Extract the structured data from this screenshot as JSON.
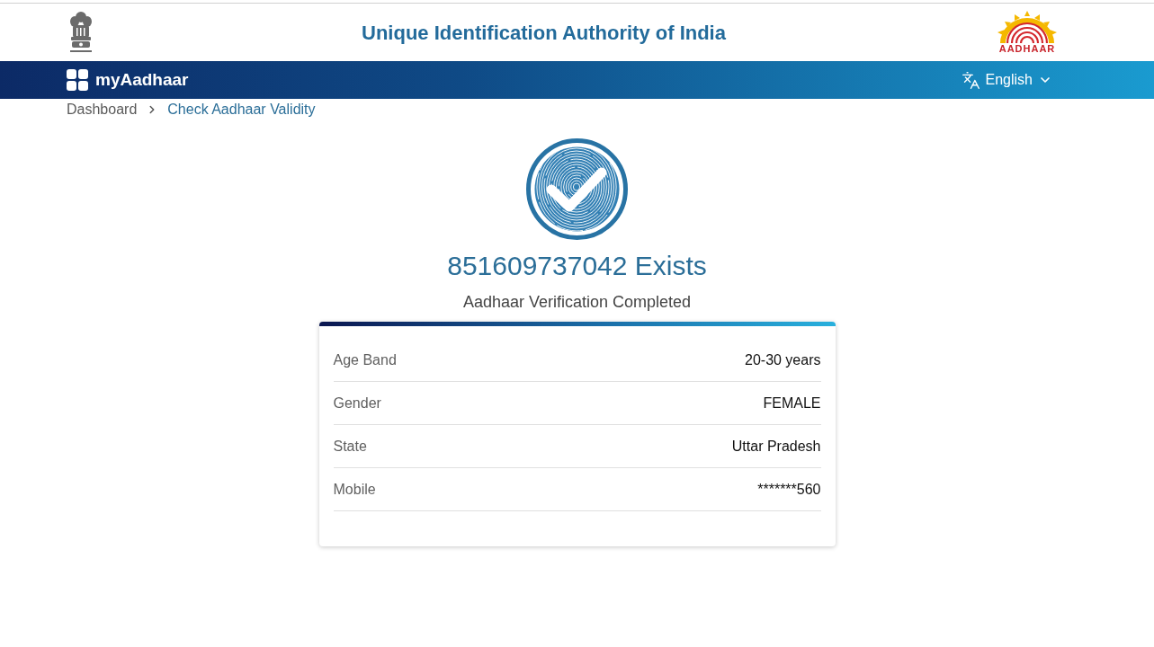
{
  "header": {
    "title": "Unique Identification Authority of India",
    "logo_text": "AADHAAR"
  },
  "navbar": {
    "brand": "myAadhaar",
    "language": "English"
  },
  "breadcrumb": [
    {
      "label": "Dashboard",
      "current": false
    },
    {
      "label": "Check Aadhaar Validity",
      "current": true
    }
  ],
  "result": {
    "heading": "851609737042 Exists",
    "subheading": "Aadhaar Verification Completed"
  },
  "details": [
    {
      "label": "Age Band",
      "value": "20-30 years"
    },
    {
      "label": "Gender",
      "value": "FEMALE"
    },
    {
      "label": "State",
      "value": "Uttar Pradesh"
    },
    {
      "label": "Mobile",
      "value": "*******560"
    }
  ]
}
